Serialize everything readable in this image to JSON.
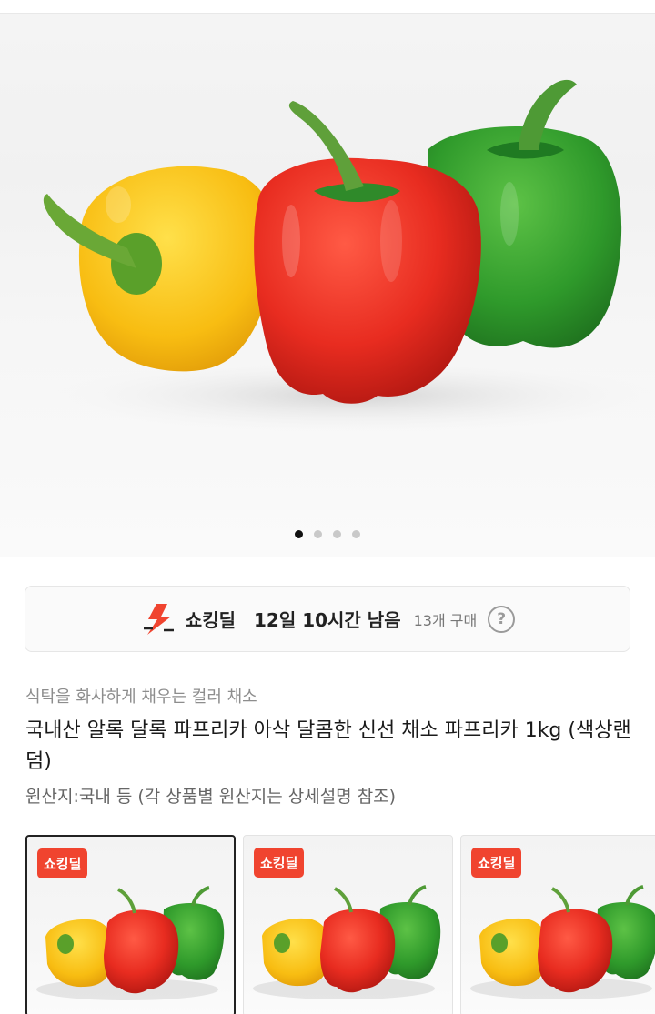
{
  "hero": {
    "image_alt": "yellow, red and green paprika",
    "carousel_index": 1,
    "carousel_total": 4
  },
  "deal": {
    "icon": "lightning-bolt-icon",
    "label": "쇼킹딜",
    "remain": "12일 10시간 남음",
    "count": "13개 구매",
    "help_icon": "question-icon",
    "accent": "#f0442f"
  },
  "product": {
    "subtitle": "식탁을 화사하게 채우는 컬러 채소",
    "title": "국내산 알록 달록 파프리카 아삭 달콤한 신선 채소 파프리카 1kg (색상랜덤)",
    "origin": "원산지:국내 등 (각 상품별 원산지는 상세설명 참조)"
  },
  "thumbnails": [
    {
      "badge": "쇼킹딜",
      "selected": true
    },
    {
      "badge": "쇼킹딜",
      "selected": false
    },
    {
      "badge": "쇼킹딜",
      "selected": false
    }
  ]
}
